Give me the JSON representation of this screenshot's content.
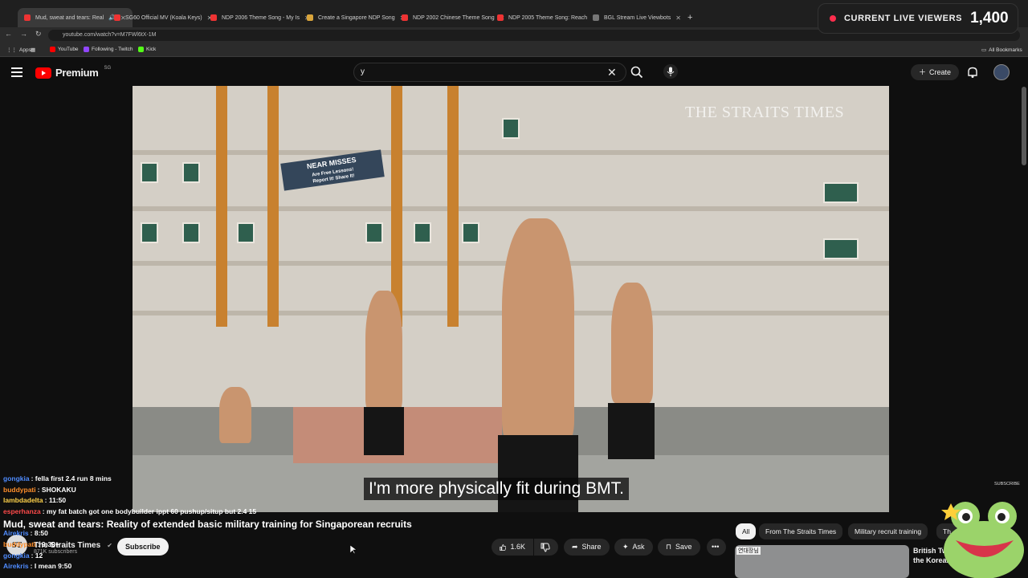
{
  "browser": {
    "tabs": [
      {
        "label": "Mud, sweat and tears: Real",
        "active": true
      },
      {
        "label": "SG60 Official MV (Koala Keys)"
      },
      {
        "label": "NDP 2006 Theme Song - My Is"
      },
      {
        "label": "Create a Singapore NDP Song"
      },
      {
        "label": "NDP 2002 Chinese Theme Song"
      },
      {
        "label": "NDP 2005 Theme Song: Reach"
      },
      {
        "label": "BGL Stream Live Viewbots"
      }
    ],
    "url": "youtube.com/watch?v=M7FWl6tX-1M",
    "bookmarks": [
      "Apps",
      "YouTube",
      "Following - Twitch",
      "Kick"
    ],
    "all_bookmarks": "All Bookmarks"
  },
  "viewer_counter": {
    "label": "CURRENT LIVE VIEWERS",
    "count": "1,400",
    "accent": "#ff2e4d"
  },
  "youtube": {
    "logo_text": "Premium",
    "logo_country": "SG",
    "search_value": "y",
    "create_label": "Create",
    "brand_color": "#ff0000"
  },
  "video": {
    "watermark": "THE STRAITS TIMES",
    "banner_line1": "NEAR MISSES",
    "banner_line2": "Are Free Lessons!",
    "banner_line3": "Report It! Share It!",
    "subtitle": "I'm more physically fit during BMT."
  },
  "chat": [
    {
      "user": "gongkia",
      "color": "#4f8cff",
      "message": "fella first 2.4 run 8 mins"
    },
    {
      "user": "buddypati",
      "color": "#ff8f2b",
      "message": "SHOKAKU"
    },
    {
      "user": "lambdadelta",
      "color": "#ffd24a",
      "message": "11:50"
    },
    {
      "user": "esperhanza",
      "color": "#ff4a4a",
      "message": "my fat batch got one bodybuilder ippt 60 pushup/situp but 2.4 15"
    },
    {
      "user": "Airekris",
      "color": "#4f8cff",
      "message": "8:50"
    },
    {
      "user": "buddypati",
      "color": "#ff8f2b",
      "message": "9:30+"
    },
    {
      "user": "gongkia",
      "color": "#4f8cff",
      "message": "12"
    },
    {
      "user": "Airekris",
      "color": "#4f8cff",
      "message": "I mean 9:50"
    }
  ],
  "watch": {
    "title": "Mud, sweat and tears: Reality of extended basic military training for Singaporean recruits",
    "channel": "The Straits Times",
    "channel_avatar": "ST",
    "subscribers": "871K subscribers",
    "subscribe_label": "Subscribe",
    "likes": "1.6K",
    "share_label": "Share",
    "ask_label": "Ask",
    "save_label": "Save"
  },
  "related": {
    "chips": [
      "All",
      "From The Straits Times",
      "Military recruit training",
      "Th"
    ],
    "first_title": "British Twins the Korean",
    "thumb_text": "연대장님",
    "overlay_label": "SUBSCRIBE"
  }
}
